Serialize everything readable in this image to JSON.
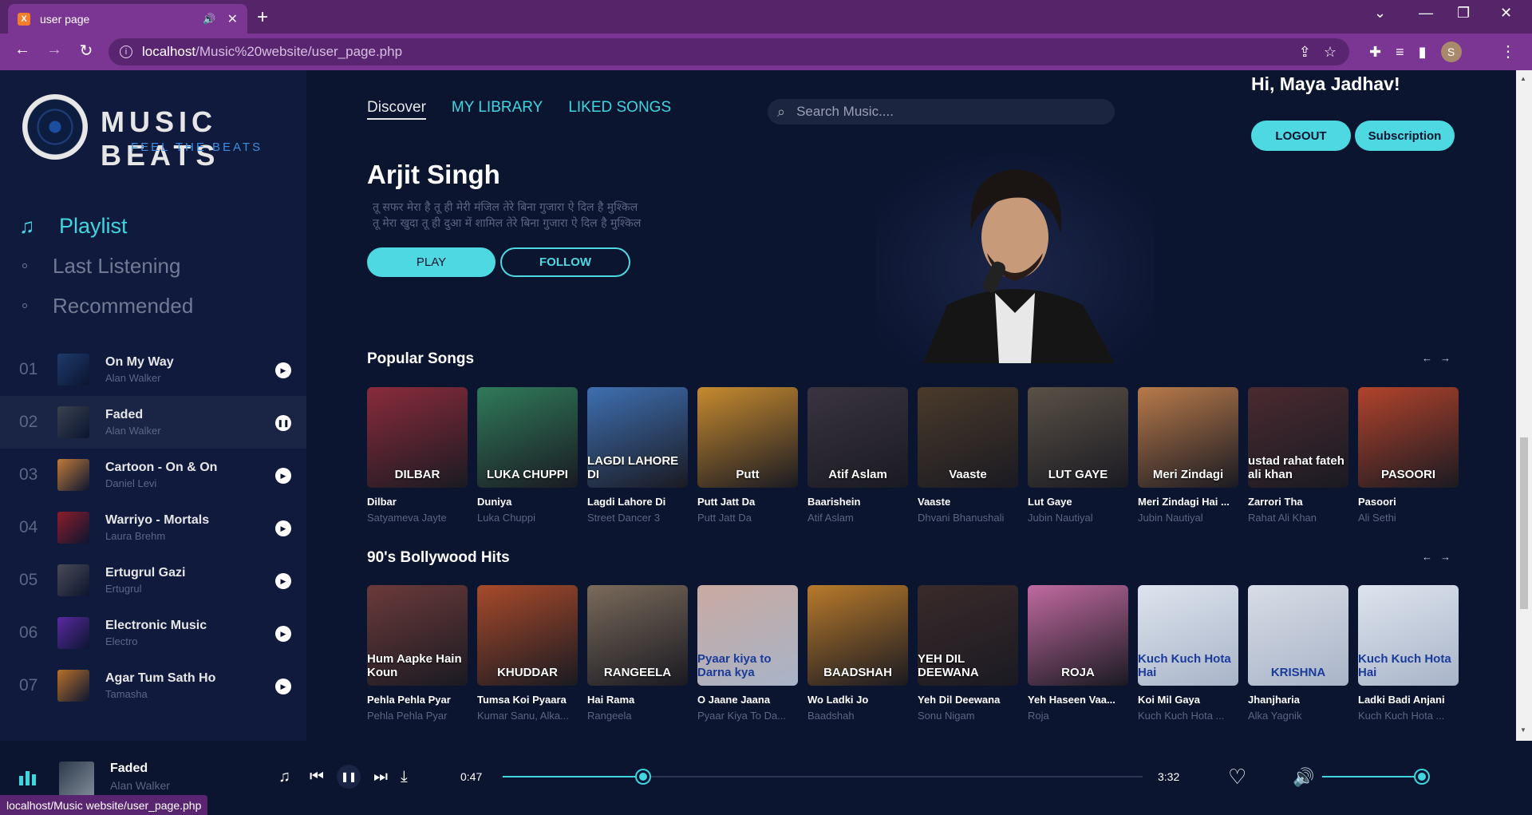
{
  "browser": {
    "tab_title": "user page",
    "url_host": "localhost",
    "url_path": "/Music%20website/user_page.php",
    "status_url": "localhost/Music website/user_page.php",
    "profile_initial": "S"
  },
  "logo": {
    "name": "MUSIC BEATS",
    "tagline": "FEEL THE BEATS"
  },
  "menu": {
    "playlist": "Playlist",
    "last_listening": "Last Listening",
    "recommended": "Recommended"
  },
  "tracks": [
    {
      "num": "01",
      "title": "On My Way",
      "artist": "Alan Walker",
      "state": "play"
    },
    {
      "num": "02",
      "title": "Faded",
      "artist": "Alan Walker",
      "state": "pause"
    },
    {
      "num": "03",
      "title": "Cartoon - On & On",
      "artist": "Daniel Levi",
      "state": "play"
    },
    {
      "num": "04",
      "title": "Warriyo - Mortals",
      "artist": "Laura Brehm",
      "state": "play"
    },
    {
      "num": "05",
      "title": "Ertugrul Gazi",
      "artist": "Ertugrul",
      "state": "play"
    },
    {
      "num": "06",
      "title": "Electronic Music",
      "artist": "Electro",
      "state": "play"
    },
    {
      "num": "07",
      "title": "Agar Tum Sath Ho",
      "artist": "Tamasha",
      "state": "play"
    }
  ],
  "nav": {
    "discover": "Discover",
    "library": "MY LIBRARY",
    "liked": "LIKED SONGS"
  },
  "search": {
    "placeholder": "Search Music...."
  },
  "user": {
    "greeting": "Hi, Maya Jadhav!",
    "logout": "LOGOUT",
    "subscription": "Subscription"
  },
  "hero": {
    "artist": "Arjit Singh",
    "line1": "तू सफर मेरा है तू ही मेरी मंजिल तेरे बिना गुजारा ऐ दिल है मुश्किल",
    "line2": "तू मेरा खुदा तू ही दुआ में शामिल तेरे बिना गुजारा ऐ दिल है मुश्किल",
    "play": "PLAY",
    "follow": "FOLLOW"
  },
  "popular": {
    "title": "Popular Songs",
    "items": [
      {
        "title": "Dilbar",
        "artist": "Satyameva Jayte",
        "cover_text": "DILBAR",
        "color": "#8a2b3b"
      },
      {
        "title": "Duniya",
        "artist": "Luka Chuppi",
        "cover_text": "LUKA CHUPPI",
        "color": "#2f7a5a"
      },
      {
        "title": "Lagdi Lahore Di",
        "artist": "Street Dancer 3",
        "cover_text": "LAGDI LAHORE DI",
        "color": "#3e6fb0"
      },
      {
        "title": "Putt Jatt Da",
        "artist": "Putt Jatt Da",
        "cover_text": "Putt",
        "color": "#c68a2f"
      },
      {
        "title": "Baarishein",
        "artist": "Atif Aslam",
        "cover_text": "Atif Aslam",
        "color": "#3a3440"
      },
      {
        "title": "Vaaste",
        "artist": "Dhvani Bhanushali",
        "cover_text": "Vaaste",
        "color": "#4a3a2a"
      },
      {
        "title": "Lut Gaye",
        "artist": "Jubin Nautiyal",
        "cover_text": "LUT GAYE",
        "color": "#5a5146"
      },
      {
        "title": "Meri Zindagi Hai ...",
        "artist": "Jubin Nautiyal",
        "cover_text": "Meri Zindagi",
        "color": "#b87a4a"
      },
      {
        "title": "Zarrori Tha",
        "artist": "Rahat Ali Khan",
        "cover_text": "ustad rahat fateh ali khan",
        "color": "#4a2a30"
      },
      {
        "title": "Pasoori",
        "artist": "Ali Sethi",
        "cover_text": "PASOORI",
        "color": "#b2432b"
      }
    ]
  },
  "bollywood": {
    "title": "90's Bollywood Hits",
    "items": [
      {
        "title": "Pehla Pehla Pyar",
        "artist": "Pehla Pehla Pyar",
        "cover_text": "Hum Aapke Hain Koun",
        "color": "#6b3a3a"
      },
      {
        "title": "Tumsa Koi Pyaara",
        "artist": "Kumar Sanu, Alka...",
        "cover_text": "KHUDDAR",
        "color": "#a84a2a"
      },
      {
        "title": "Hai Rama",
        "artist": "Rangeela",
        "cover_text": "RANGEELA",
        "color": "#7a6a5a"
      },
      {
        "title": "O Jaane Jaana",
        "artist": "Pyaar Kiya To Da...",
        "cover_text": "Pyaar kiya to Darna kya",
        "color": "#c9a9a0"
      },
      {
        "title": "Wo Ladki Jo",
        "artist": "Baadshah",
        "cover_text": "BAADSHAH",
        "color": "#b87a2a"
      },
      {
        "title": "Yeh Dil Deewana",
        "artist": "Sonu Nigam",
        "cover_text": "YEH DIL DEEWANA",
        "color": "#3a2a2a"
      },
      {
        "title": "Yeh Haseen Vaa...",
        "artist": "Roja",
        "cover_text": "ROJA",
        "color": "#c06aa0"
      },
      {
        "title": "Koi Mil Gaya",
        "artist": "Kuch Kuch Hota ...",
        "cover_text": "Kuch Kuch Hota Hai",
        "color": "#dde4ee"
      },
      {
        "title": "Jhanjharia",
        "artist": "Alka Yagnik",
        "cover_text": "KRISHNA",
        "color": "#d8dde6"
      },
      {
        "title": "Ladki Badi Anjani",
        "artist": "Kuch Kuch Hota ...",
        "cover_text": "Kuch Kuch Hota Hai",
        "color": "#dde4ee"
      }
    ]
  },
  "player": {
    "title": "Faded",
    "artist": "Alan Walker",
    "current_time": "0:47",
    "duration": "3:32",
    "progress": 0.22,
    "volume": 1.0
  },
  "colors": {
    "accent": "#4ed8e2",
    "bg": "#0b1530",
    "sidebar": "#101a3d",
    "chrome": "#7b3694"
  },
  "icons": [
    "music-note-icon",
    "search-icon",
    "play-icon",
    "pause-icon",
    "prev-icon",
    "next-icon",
    "download-icon",
    "heart-icon",
    "volume-icon",
    "equalizer-icon"
  ]
}
